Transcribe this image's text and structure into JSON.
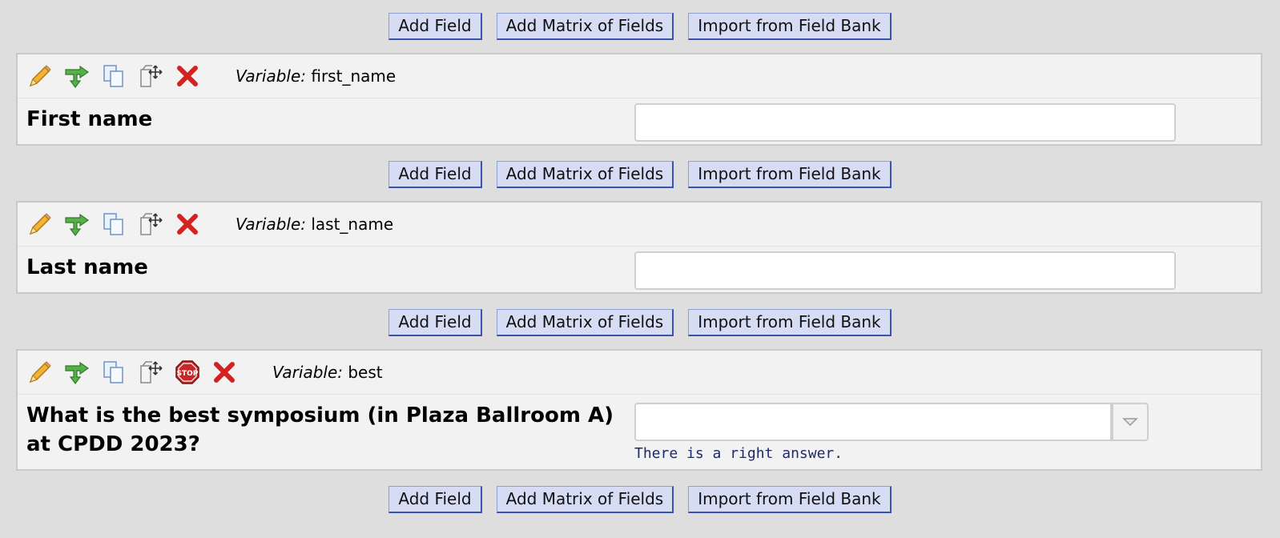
{
  "buttons": {
    "add_field": "Add Field",
    "add_matrix": "Add Matrix of Fields",
    "import_bank": "Import from Field Bank"
  },
  "variable_prefix": "Variable:",
  "fields": [
    {
      "variable": "first_name",
      "label": "First name",
      "input_value": ""
    },
    {
      "variable": "last_name",
      "label": "Last name",
      "input_value": ""
    },
    {
      "variable": "best",
      "label": "What is the best symposium (in Plaza Ballroom A) at CPDD 2023?",
      "input_value": "",
      "note": "There is a right answer."
    }
  ],
  "icons": [
    "pencil-icon",
    "branch-arrow-icon",
    "copy-icon",
    "move-icon",
    "stop-icon",
    "delete-icon"
  ],
  "colors": {
    "background": "#dedede",
    "field_background": "#f2f2f2",
    "button_background": "#d6dcf4",
    "button_border": "#3a52b2",
    "note_text": "#1f2a6b",
    "delete_red": "#d42222",
    "stop_red": "#c62828"
  }
}
